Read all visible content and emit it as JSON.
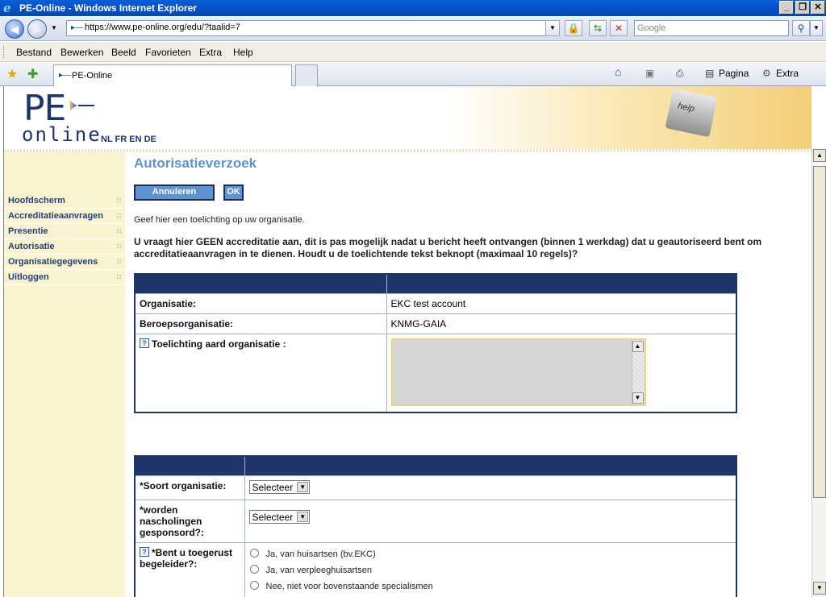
{
  "window": {
    "title": "PE-Online - Windows Internet Explorer",
    "minimize": "_",
    "maximize": "❐",
    "close": "✕"
  },
  "addressbar": {
    "url": "https://www.pe-online.org/edu/?taalid=7",
    "search_placeholder": "Google"
  },
  "menubar": {
    "items": [
      "Bestand",
      "Bewerken",
      "Beeld",
      "Favorieten",
      "Extra",
      "Help"
    ]
  },
  "favbar": {
    "tab_title": "PE-Online",
    "page_label": "Pagina",
    "tools_label": "Extra"
  },
  "banner": {
    "logo_pe": "PE",
    "logo_online": "online",
    "languages": "NL FR EN DE",
    "help_key": "help"
  },
  "sidebar": {
    "items": [
      "Hoofdscherm",
      "Accreditatieaanvragen",
      "Presentie",
      "Autorisatie",
      "Organisatiegegevens",
      "Uitloggen"
    ]
  },
  "main": {
    "title": "Autorisatieverzoek",
    "cancel_button": "Annuleren",
    "ok_button": "OK",
    "intro": "Geef hier een toelichting op uw organisatie.",
    "warning": "U vraagt hier GEEN accreditatie aan, dit is pas mogelijk nadat u bericht heeft ontvangen (binnen 1 werkdag) dat u geautoriseerd bent om accreditatieaanvragen in te dienen. Houdt u de toelichtende tekst beknopt (maximaal 10 regels)?"
  },
  "table1": {
    "rows": [
      {
        "label": "Organisatie:",
        "value": "EKC test account"
      },
      {
        "label": "Beroepsorganisatie:",
        "value": "KNMG-GAIA"
      }
    ],
    "toelichting_label": "Toelichting aard organisatie :",
    "help_icon": "?"
  },
  "table2": {
    "soort_label": "*Soort organisatie:",
    "soort_value": "Selecteer",
    "gesponsord_label": "*worden nascholingen gesponsord?:",
    "gesponsord_value": "Selecteer",
    "begeleider_label": "*Bent u toegerust begeleider?:",
    "help_icon": "?",
    "options": [
      "Ja, van huisartsen (bv.EKC)",
      "Ja, van verpleeghuisartsen",
      "Nee, niet voor bovenstaande specialismen"
    ]
  },
  "colors": {
    "navy": "#1f3568",
    "accent_blue": "#5b94d0",
    "sidebar_bg": "#f9f3cf"
  }
}
